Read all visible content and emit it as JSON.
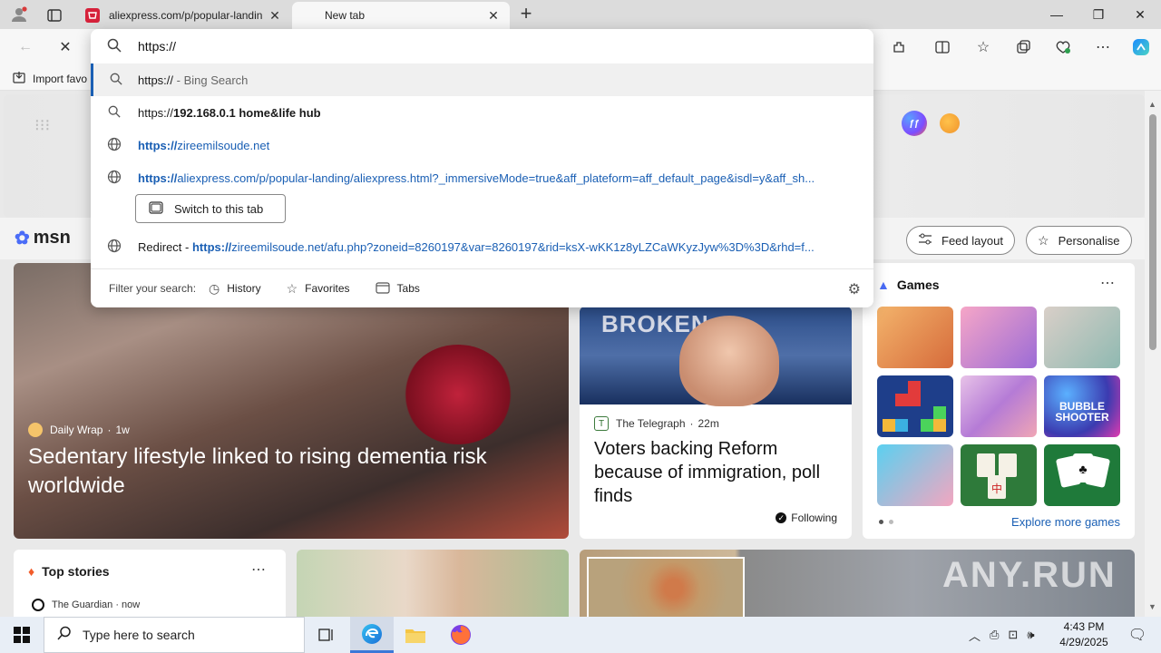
{
  "tabs": [
    {
      "title": "aliexpress.com/p/popular-landin",
      "active": false
    },
    {
      "title": "New tab",
      "active": true
    }
  ],
  "window_controls": {
    "minimize": "—",
    "maximize": "❐",
    "close": "✕"
  },
  "favorites_bar": {
    "import_label": "Import favo"
  },
  "omnibox": {
    "value": "https://",
    "suggestions": [
      {
        "icon": "search-icon",
        "prefix": "https://",
        "suffix": " - Bing Search"
      },
      {
        "icon": "search-icon",
        "prefix": "https://",
        "bold": "192.168.0.1 home&life hub"
      },
      {
        "icon": "globe-icon",
        "prefix": "https://",
        "rest": "zireemilsoude.net"
      },
      {
        "icon": "globe-icon",
        "prefix": "https://",
        "rest": "aliexpress.com/p/popular-landing/aliexpress.html?_immersiveMode=true&aff_plateform=aff_default_page&isdl=y&aff_sh..."
      },
      {
        "icon": "globe-icon",
        "lead": "Redirect - ",
        "prefix": "https://",
        "rest": "zireemilsoude.net/afu.php?zoneid=8260197&var=8260197&rid=ksX-wKK1z8yLZCaWKyzJyw%3D%3D&rhd=f..."
      }
    ],
    "switch_tab_label": "Switch to this tab",
    "filter": {
      "label": "Filter your search:",
      "history": "History",
      "favorites": "Favorites",
      "tabs": "Tabs"
    }
  },
  "msn": {
    "logo": "msn",
    "feed_layout": "Feed layout",
    "personalise": "Personalise"
  },
  "main_story": {
    "source": "Daily Wrap",
    "age": "1w",
    "headline": "Sedentary lifestyle linked to rising dementia risk worldwide"
  },
  "second_story": {
    "image_text": "BROKEN",
    "source": "The Telegraph",
    "age": "22m",
    "headline": "Voters backing Reform because of immigration, poll finds",
    "following": "Following"
  },
  "games": {
    "title": "Games",
    "explore": "Explore more games",
    "tile_text": "BUBBLE SHOOTER"
  },
  "top_stories": {
    "title": "Top stories",
    "source": "The Guardian · now"
  },
  "watermark": "ANY.RUN",
  "taskbar": {
    "search_placeholder": "Type here to search",
    "time": "4:43 PM",
    "date": "4/29/2025"
  },
  "colors": {
    "accent": "#1a5fb4",
    "edge_blue": "#3b78d8"
  }
}
